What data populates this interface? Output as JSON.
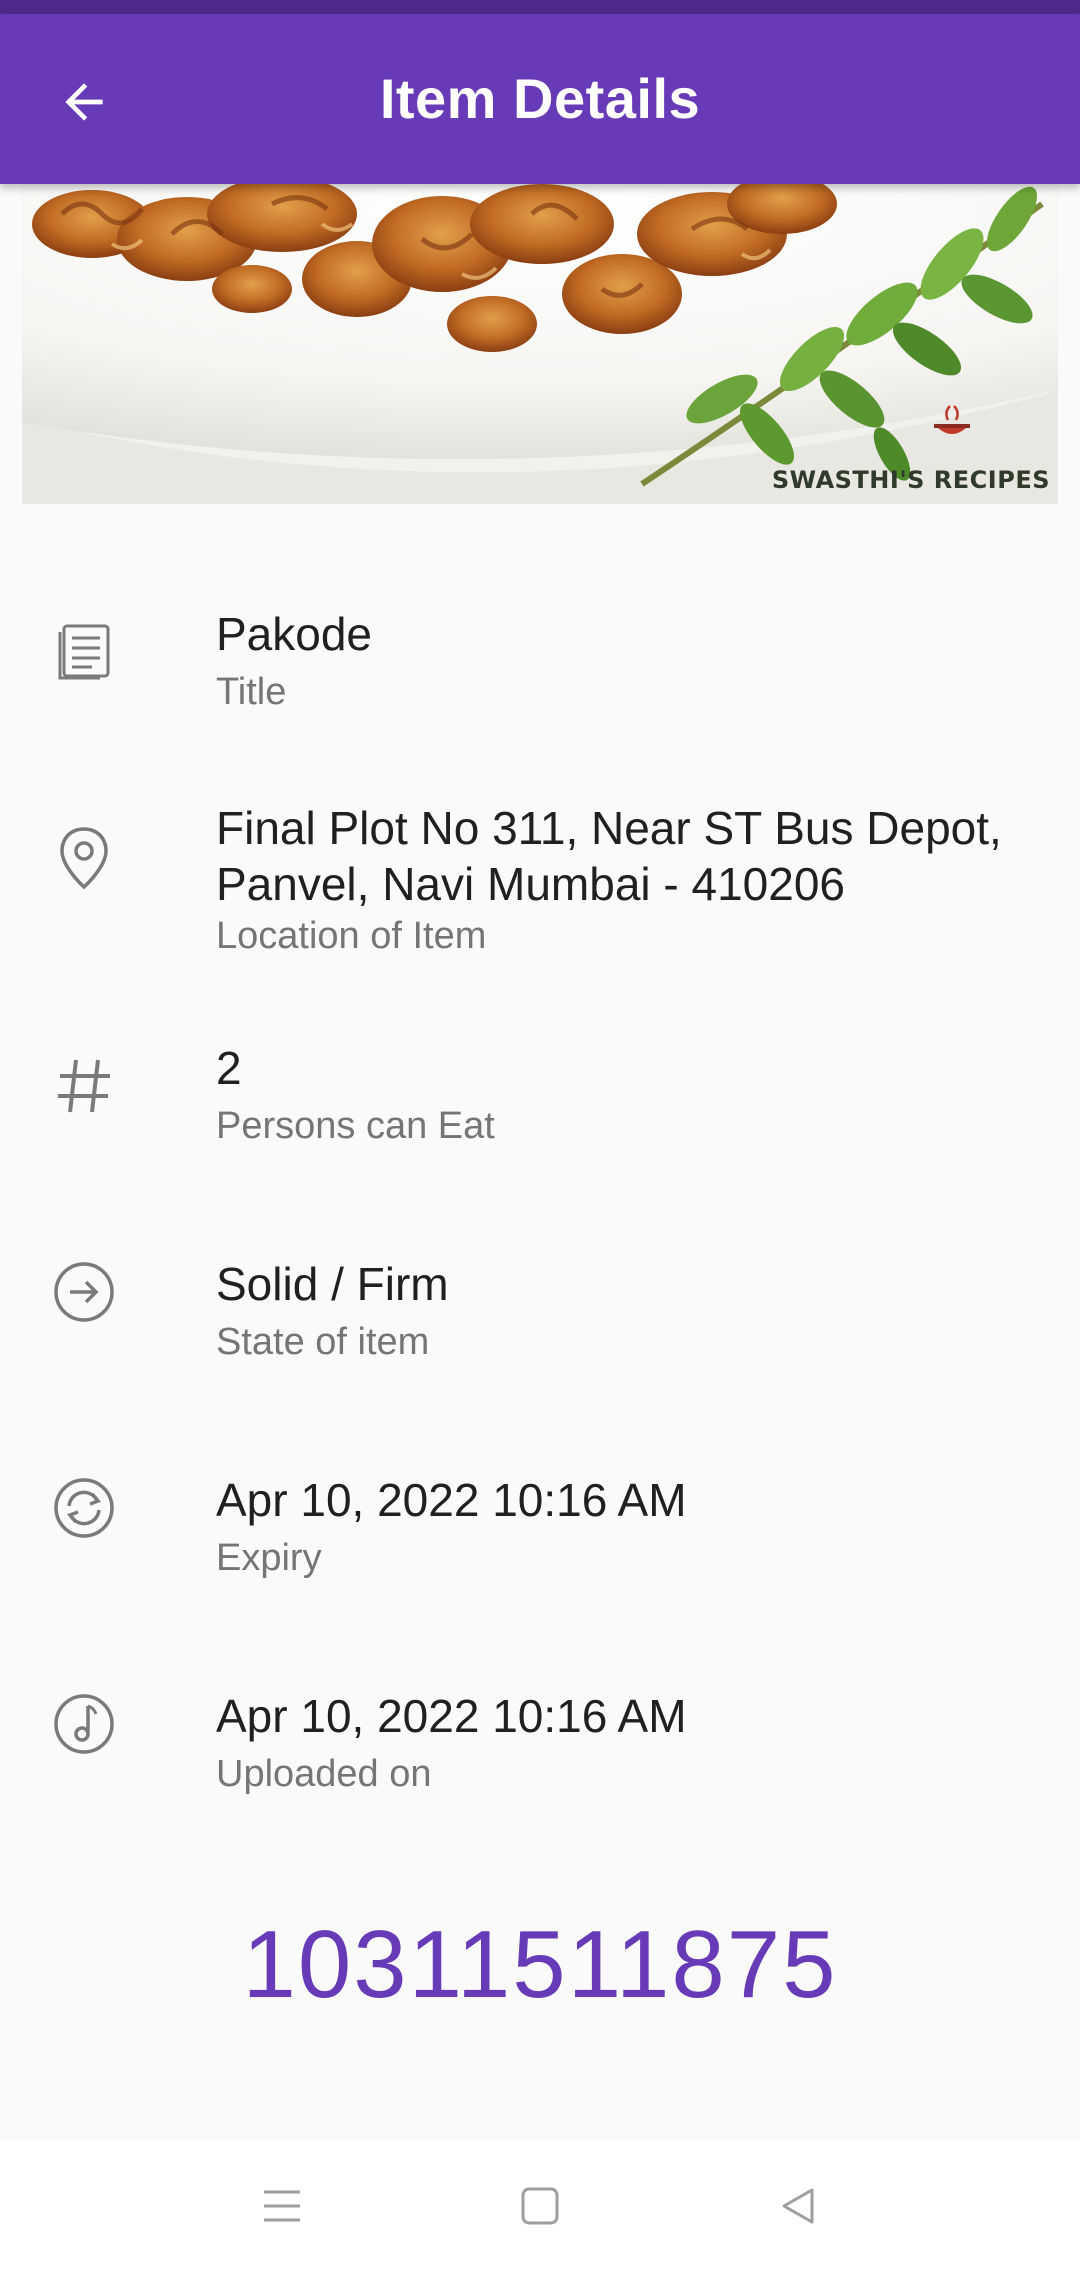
{
  "app_bar": {
    "title": "Item Details",
    "background_color": "#673ab7",
    "back_icon": "arrow-back-icon"
  },
  "hero_image": {
    "watermark": "SWASTHI'S RECIPES"
  },
  "details": [
    {
      "icon": "document-icon",
      "value": "Pakode",
      "label": "Title"
    },
    {
      "icon": "location-pin-icon",
      "value": "Final Plot No 311, Near ST Bus Depot, Panvel, Navi Mumbai - 410206",
      "label": "Location of Item"
    },
    {
      "icon": "hash-icon",
      "value": "2",
      "label": "Persons can Eat"
    },
    {
      "icon": "arrow-circle-icon",
      "value": "Solid / Firm",
      "label": "State of item"
    },
    {
      "icon": "refresh-circle-icon",
      "value": "Apr 10, 2022 10:16 AM",
      "label": "Expiry"
    },
    {
      "icon": "clock-circle-icon",
      "value": "Apr 10, 2022 10:16 AM",
      "label": "Uploaded on"
    }
  ],
  "code": "10311511875",
  "accent_color": "#673ab7",
  "nav_bar": {
    "icons": [
      "menu-icon",
      "home-square-icon",
      "back-triangle-icon"
    ]
  }
}
